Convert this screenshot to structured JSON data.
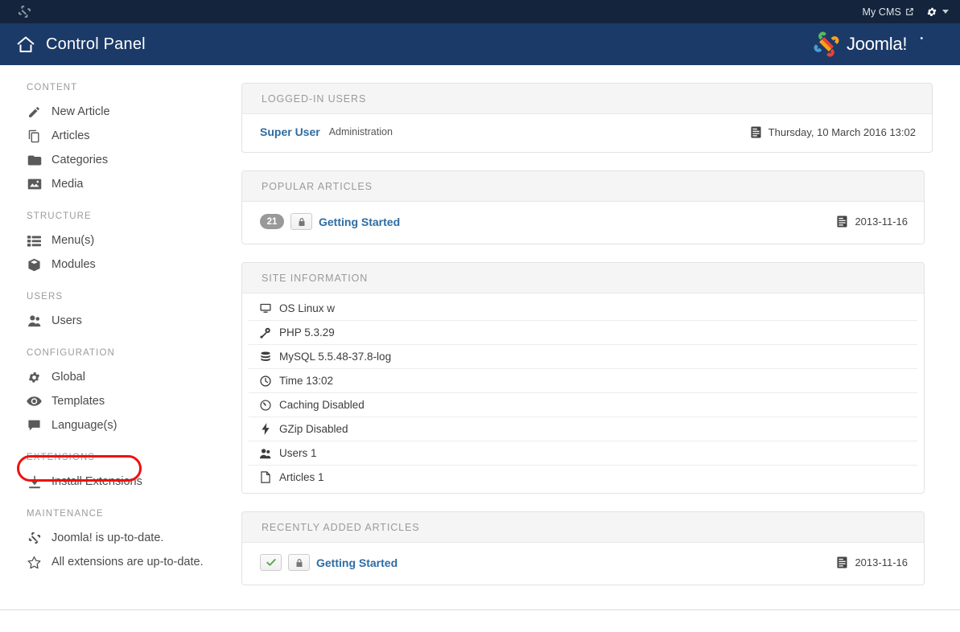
{
  "topbar": {
    "site_link": "My CMS",
    "icons": {
      "external": "external-link-icon",
      "gear": "gear-icon",
      "joomla": "joomla-icon"
    }
  },
  "titlebar": {
    "title": "Control Panel",
    "home_icon": "home-icon",
    "brand": "Joomla!"
  },
  "sidebar": {
    "groups": [
      {
        "heading": "CONTENT",
        "items": [
          {
            "label": "New Article",
            "icon": "pencil-icon"
          },
          {
            "label": "Articles",
            "icon": "copy-icon"
          },
          {
            "label": "Categories",
            "icon": "folder-icon"
          },
          {
            "label": "Media",
            "icon": "image-icon"
          }
        ]
      },
      {
        "heading": "STRUCTURE",
        "items": [
          {
            "label": "Menu(s)",
            "icon": "list-icon"
          },
          {
            "label": "Modules",
            "icon": "cube-icon"
          }
        ]
      },
      {
        "heading": "USERS",
        "items": [
          {
            "label": "Users",
            "icon": "users-icon"
          }
        ]
      },
      {
        "heading": "CONFIGURATION",
        "items": [
          {
            "label": "Global",
            "icon": "gear-icon"
          },
          {
            "label": "Templates",
            "icon": "eye-icon",
            "highlighted": true
          },
          {
            "label": "Language(s)",
            "icon": "comment-icon"
          }
        ]
      },
      {
        "heading": "EXTENSIONS",
        "items": [
          {
            "label": "Install Extensions",
            "icon": "download-icon"
          }
        ]
      },
      {
        "heading": "MAINTENANCE",
        "items": [
          {
            "label": "Joomla! is up-to-date.",
            "icon": "joomla-icon"
          },
          {
            "label": "All extensions are up-to-date.",
            "icon": "star-icon"
          }
        ]
      }
    ]
  },
  "panels": {
    "logged_in_users": {
      "title": "LOGGED-IN USERS",
      "rows": [
        {
          "name": "Super User",
          "role": "Administration",
          "date": "Thursday, 10 March 2016 13:02",
          "date_icon": "calendar-icon"
        }
      ]
    },
    "popular_articles": {
      "title": "POPULAR ARTICLES",
      "rows": [
        {
          "count": "21",
          "lock_icon": "lock-icon",
          "title": "Getting Started",
          "date": "2013-11-16",
          "date_icon": "calendar-icon"
        }
      ]
    },
    "site_information": {
      "title": "SITE INFORMATION",
      "rows": [
        {
          "label": "OS Linux w",
          "icon": "monitor-icon"
        },
        {
          "label": "PHP 5.3.29",
          "icon": "wrench-icon"
        },
        {
          "label": "MySQL 5.5.48-37.8-log",
          "icon": "database-icon"
        },
        {
          "label": "Time 13:02",
          "icon": "clock-icon"
        },
        {
          "label": "Caching Disabled",
          "icon": "dashboard-icon"
        },
        {
          "label": "GZip Disabled",
          "icon": "bolt-icon"
        },
        {
          "label": "Users 1",
          "icon": "users-icon"
        },
        {
          "label": "Articles 1",
          "icon": "file-icon"
        }
      ]
    },
    "recently_added_articles": {
      "title": "RECENTLY ADDED ARTICLES",
      "rows": [
        {
          "check_icon": "check-icon",
          "lock_icon": "lock-icon",
          "title": "Getting Started",
          "date": "2013-11-16",
          "date_icon": "calendar-icon"
        }
      ]
    }
  },
  "colors": {
    "topbar": "#13243c",
    "titlebar": "#1b3a68",
    "link": "#2d6ca2",
    "highlight": "#ee1111",
    "badge": "#999999",
    "check_green": "#5aa34f"
  }
}
